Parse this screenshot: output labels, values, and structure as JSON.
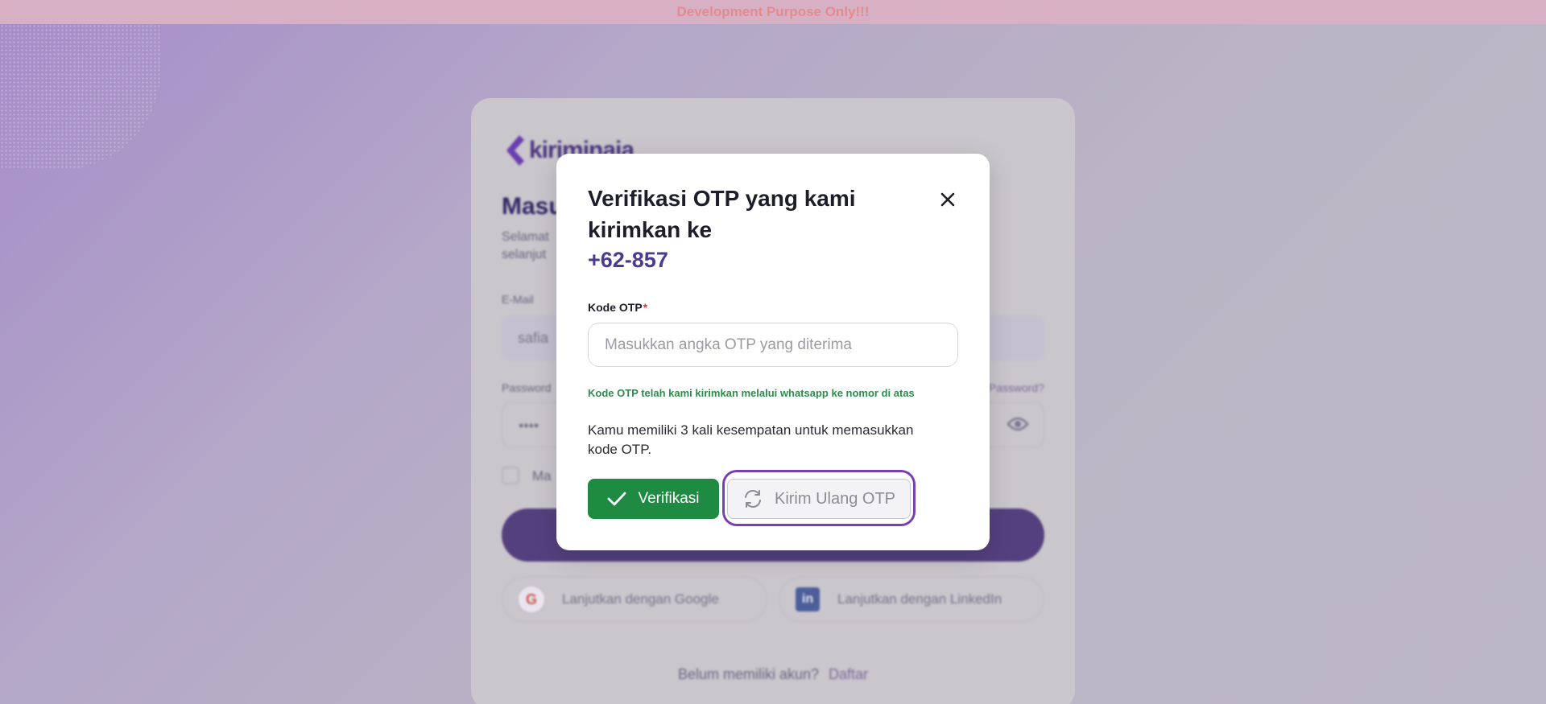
{
  "banner": {
    "text": "Development Purpose Only!!!"
  },
  "background_login": {
    "brand": "kiriminaja",
    "title": "Masu",
    "subtitle_line1": "Selamat",
    "subtitle_line2": "selanjut",
    "email_label": "E-Mail",
    "email_value": "safia",
    "password_label": "Password",
    "password_value": "••••",
    "forgot_label": "Password?",
    "remember_label": "Ma",
    "google_label": "Lanjutkan dengan Google",
    "linkedin_label": "Lanjutkan dengan LinkedIn",
    "register_prompt": "Belum memiliki akun?",
    "register_link": "Daftar"
  },
  "modal": {
    "title": "Verifikasi OTP yang kami kirimkan ke",
    "phone": "+62-857",
    "otp_label": "Kode OTP",
    "otp_required_mark": "*",
    "otp_placeholder": "Masukkan angka OTP yang diterima",
    "otp_value": "",
    "hint": "Kode OTP telah kami kirimkan melalui whatsapp ke nomor di atas",
    "attempts_prefix": "Kamu memiliki",
    "attempts_count": "3",
    "attempts_suffix": "kali kesempatan untuk memasukkan kode OTP.",
    "verify_label": "Verifikasi",
    "resend_label": "Kirim Ulang OTP"
  },
  "icons": {
    "close": "close-icon",
    "check": "check-icon",
    "refresh": "refresh-icon",
    "eye": "eye-icon",
    "google": "google-icon",
    "linkedin": "linkedin-icon"
  },
  "colors": {
    "brand_purple": "#4d3a8f",
    "verify_green": "#1f8b42",
    "hint_green": "#2e8b4c",
    "focus_ring": "#7a3fb4",
    "required_red": "#dd3333"
  }
}
